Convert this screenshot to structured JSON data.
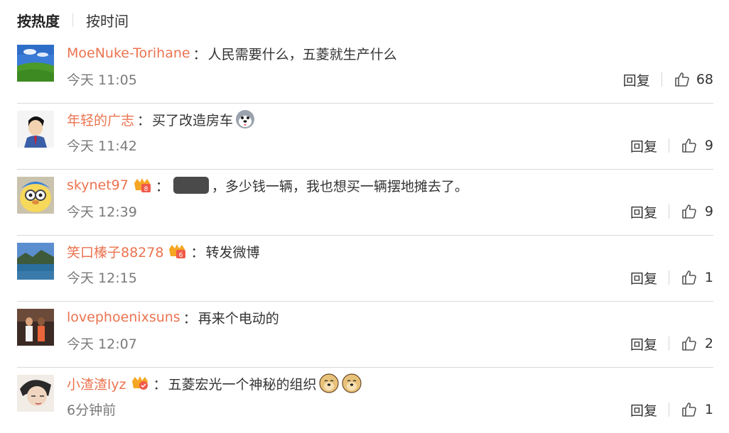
{
  "sort": {
    "hot": "按热度",
    "time": "按时间"
  },
  "comments": [
    {
      "user": "MoeNuke-Torihane",
      "text": "人民需要什么，五菱就生产什么",
      "time": "今天 11:05",
      "reply": "回复",
      "likes": "68"
    },
    {
      "user": "年轻的广志",
      "text": "买了改造房车",
      "time": "今天 11:42",
      "reply": "回复",
      "likes": "9"
    },
    {
      "user": "skynet97",
      "text": "，多少钱一辆，我也想买一辆摆地摊去了。",
      "time": "今天 12:39",
      "reply": "回复",
      "likes": "9"
    },
    {
      "user": "笑口榛子88278",
      "text": "转发微博",
      "time": "今天 12:15",
      "reply": "回复",
      "likes": "1"
    },
    {
      "user": "lovephoenixsuns",
      "text": "再来个电动的",
      "time": "今天 12:07",
      "reply": "回复",
      "likes": "2"
    },
    {
      "user": "小渣渣lyz",
      "text": "五菱宏光一个神秘的组织",
      "time": "6分钟前",
      "reply": "回复",
      "likes": "1"
    }
  ],
  "colors": {
    "username": "#eb7350",
    "time": "#7a7a7a",
    "divider": "#d9d9d9"
  },
  "icons": {
    "like": "thumbs-up-icon",
    "badge": "vip-crown-badge-icon",
    "emoji_dog": "doge-emoji-icon",
    "emoji_husky": "husky-emoji-icon"
  }
}
